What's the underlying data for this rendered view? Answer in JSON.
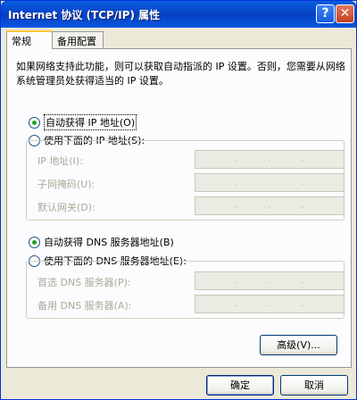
{
  "window": {
    "title": "Internet 协议 (TCP/IP) 属性",
    "help_glyph": "?",
    "close_glyph": "✕"
  },
  "tabs": [
    {
      "label": "常规",
      "selected": true
    },
    {
      "label": "备用配置",
      "selected": false
    }
  ],
  "description": "如果网络支持此功能，则可以获取自动指派的 IP 设置。否则，您需要从网络系统管理员处获得适当的 IP 设置。",
  "ip_section": {
    "auto_label": "自动获得 IP 地址(O)",
    "auto_checked": true,
    "manual_label": "使用下面的 IP 地址(S):",
    "manual_checked": false,
    "fields": [
      {
        "label": "IP 地址(I):"
      },
      {
        "label": "子网掩码(U):"
      },
      {
        "label": "默认网关(D):"
      }
    ]
  },
  "dns_section": {
    "auto_label": "自动获得 DNS 服务器地址(B)",
    "auto_checked": true,
    "manual_label": "使用下面的 DNS 服务器地址(E):",
    "manual_checked": false,
    "fields": [
      {
        "label": "首选 DNS 服务器(P):"
      },
      {
        "label": "备用 DNS 服务器(A):"
      }
    ]
  },
  "ip_dot": ".",
  "buttons": {
    "advanced": "高级(V)...",
    "ok": "确定",
    "cancel": "取消"
  }
}
